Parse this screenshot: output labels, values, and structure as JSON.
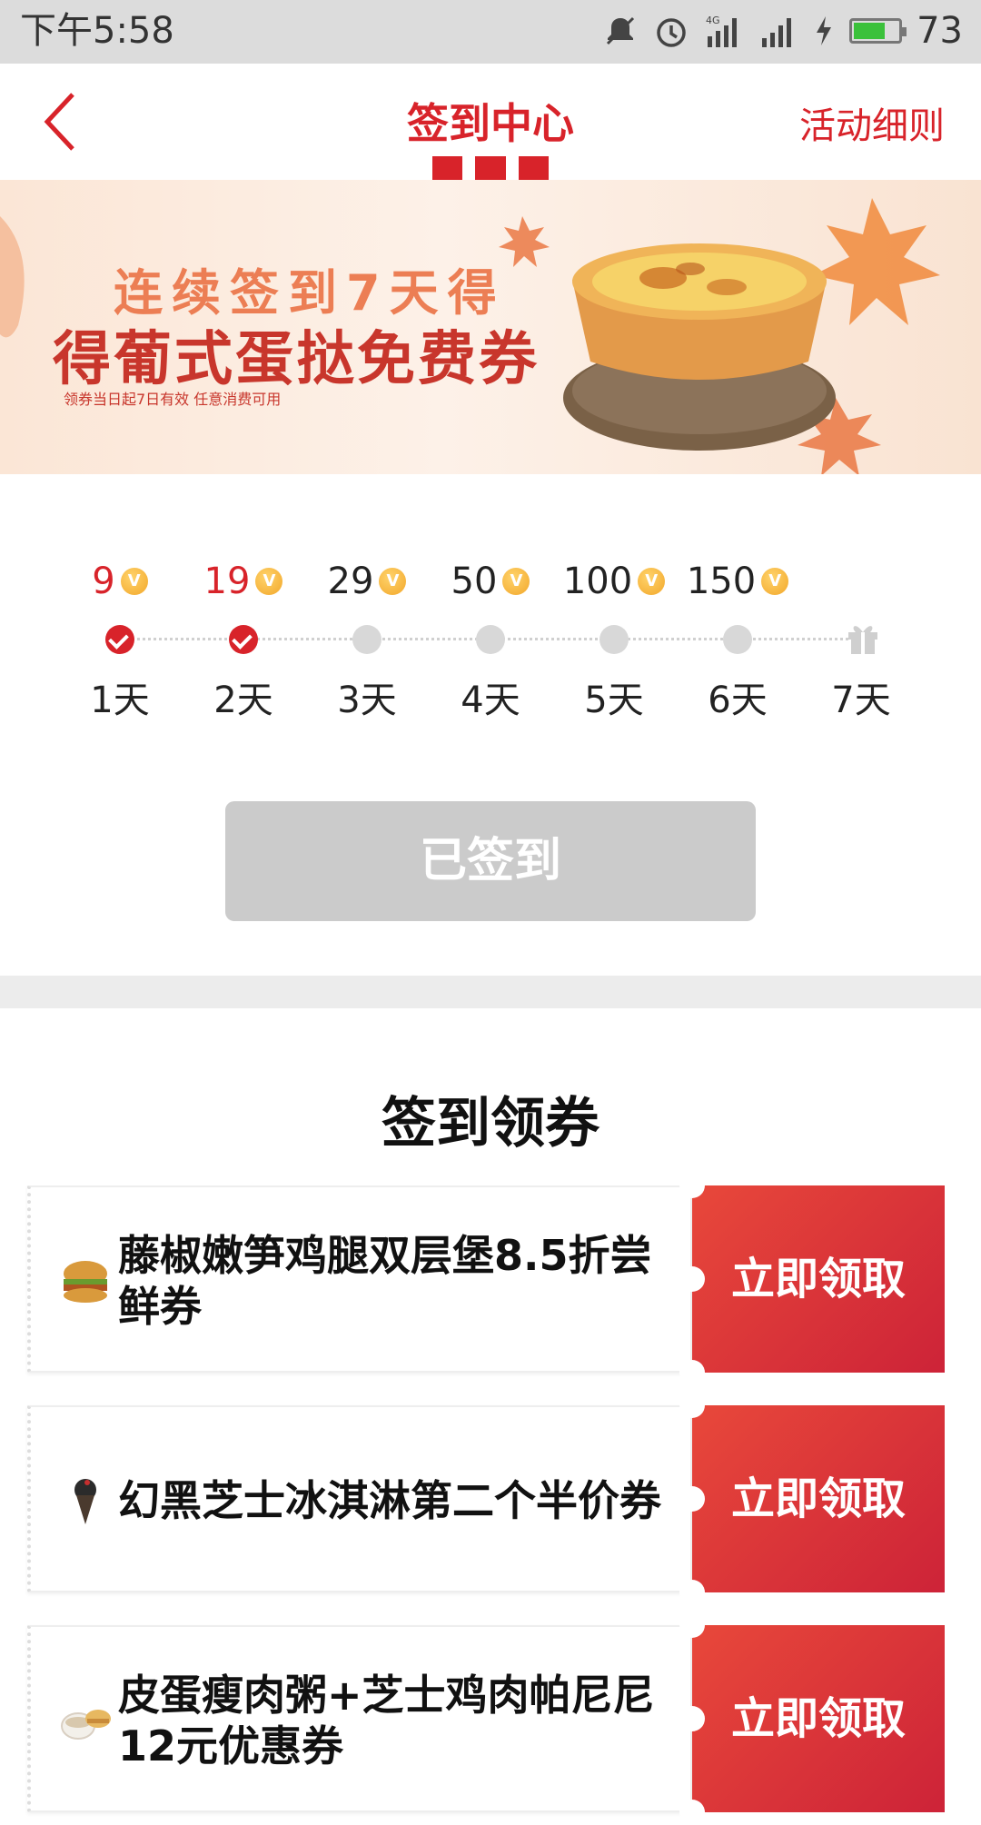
{
  "status_bar": {
    "time": "下午5:58",
    "network": "4G",
    "battery": "73",
    "battery_level": 0.73
  },
  "nav": {
    "title": "签到中心",
    "rules_link": "活动细则"
  },
  "banner": {
    "line1": "连续签到7天得",
    "line2": "得葡式蛋挞免费券",
    "note": "领券当日起7日有效 任意消费可用"
  },
  "checkin": {
    "days": [
      {
        "points": "9",
        "label": "1天",
        "checked": true
      },
      {
        "points": "19",
        "label": "2天",
        "checked": true
      },
      {
        "points": "29",
        "label": "3天",
        "checked": false
      },
      {
        "points": "50",
        "label": "4天",
        "checked": false
      },
      {
        "points": "100",
        "label": "5天",
        "checked": false
      },
      {
        "points": "150",
        "label": "6天",
        "checked": false
      },
      {
        "points": "",
        "label": "7天",
        "checked": false,
        "gift": true
      }
    ],
    "coin_symbol": "V",
    "button_label": "已签到"
  },
  "coupons_section": {
    "title": "签到领券",
    "items": [
      {
        "title": "藤椒嫩笋鸡腿双层堡8.5折尝鲜券",
        "icon": "burger-icon",
        "action": "立即领取"
      },
      {
        "title": "幻黑芝士冰淇淋第二个半价券",
        "icon": "ice-cream-icon",
        "action": "立即领取"
      },
      {
        "title": "皮蛋瘦肉粥+芝士鸡肉帕尼尼12元优惠券",
        "icon": "porridge-icon",
        "action": "立即领取"
      }
    ]
  },
  "colors": {
    "brand_red": "#d8232a",
    "disabled_grey": "#cbcbcb"
  }
}
